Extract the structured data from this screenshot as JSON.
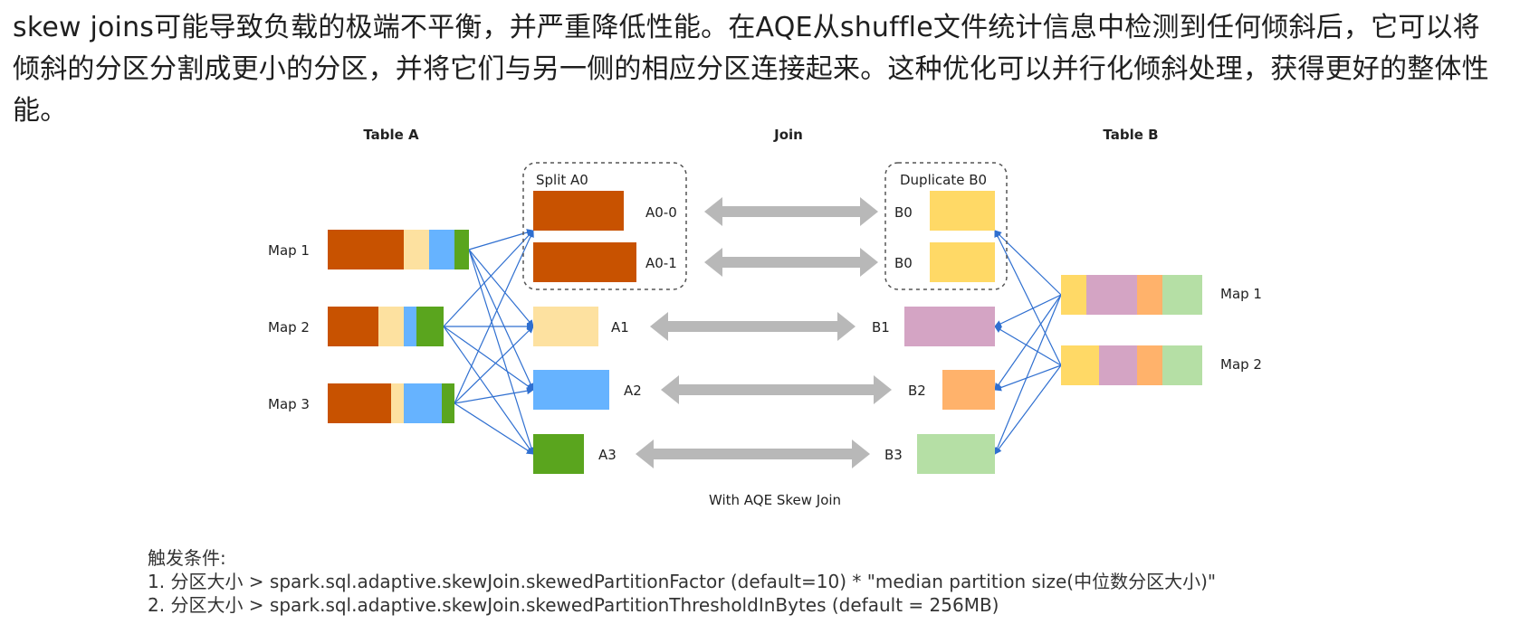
{
  "intro_text": "skew joins可能导致负载的极端不平衡，并严重降低性能。在AQE从shuffle文件统计信息中检测到任何倾斜后，它可以将倾斜的分区分割成更小的分区，并将它们与另一侧的相应分区连接起来。这种优化可以并行化倾斜处理，获得更好的整体性能。",
  "diagram": {
    "headers": {
      "table_a": "Table A",
      "join": "Join",
      "table_b": "Table B"
    },
    "caption": "With AQE Skew Join",
    "left_maps": [
      "Map 1",
      "Map 2",
      "Map 3"
    ],
    "right_maps": [
      "Map 1",
      "Map 2"
    ],
    "split_group": {
      "title": "Split A0",
      "parts": [
        "A0-0",
        "A0-1"
      ]
    },
    "duplicate_group": {
      "title": "Duplicate B0",
      "parts": [
        "B0",
        "B0"
      ]
    },
    "a_partitions": [
      "A1",
      "A2",
      "A3"
    ],
    "b_partitions": [
      "B1",
      "B2",
      "B3"
    ],
    "colors": {
      "orange": "#c85200",
      "light_yellow": "#fde1a0",
      "blue": "#66b3ff",
      "green": "#5aa51e",
      "yellow": "#ffd966",
      "pink": "#d4a4c4",
      "peach": "#ffb26b",
      "light_green": "#b5dfa5",
      "arrow": "#b8b8b8",
      "line": "#2f6fd0"
    }
  },
  "notes": {
    "title": "触发条件:",
    "line1": "1. 分区大小 > spark.sql.adaptive.skewJoin.skewedPartitionFactor (default=10) * \"median partition size(中位数分区大小)\"",
    "line2": "2. 分区大小 > spark.sql.adaptive.skewJoin.skewedPartitionThresholdInBytes (default = 256MB)"
  }
}
